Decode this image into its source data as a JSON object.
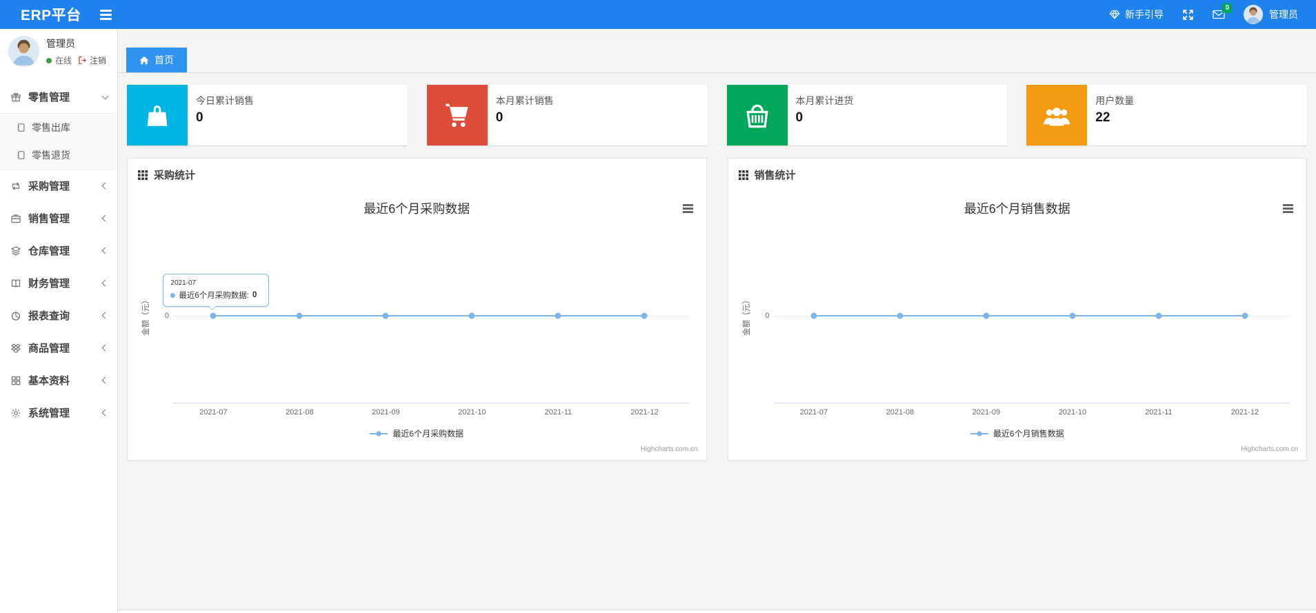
{
  "colors": {
    "navbar": "#1e82ec",
    "active_tab": "#3193f0",
    "series_line": "#7cb5ec",
    "badge_green": "#00a65a",
    "online_green": "#3c9a40",
    "logout_red": "#dd4b39"
  },
  "navbar": {
    "brand": "ERP平台",
    "guide_label": "新手引导",
    "mail_badge": "0",
    "user_name": "管理员"
  },
  "sidebar": {
    "user": {
      "name": "管理员",
      "status": "在线",
      "logout": "注销"
    },
    "menu": [
      {
        "label": "零售管理",
        "icon": "gift-icon",
        "expanded": true,
        "children": [
          {
            "label": "零售出库",
            "icon": "journal-icon"
          },
          {
            "label": "零售退货",
            "icon": "journal-icon"
          }
        ]
      },
      {
        "label": "采购管理",
        "icon": "repeat-icon"
      },
      {
        "label": "销售管理",
        "icon": "briefcase-icon"
      },
      {
        "label": "仓库管理",
        "icon": "layers-icon"
      },
      {
        "label": "财务管理",
        "icon": "book-open-icon"
      },
      {
        "label": "报表查询",
        "icon": "pie-chart-icon"
      },
      {
        "label": "商品管理",
        "icon": "dropbox-icon"
      },
      {
        "label": "基本资料",
        "icon": "grid-icon"
      },
      {
        "label": "系统管理",
        "icon": "gear-icon"
      }
    ]
  },
  "breadcrumb": {
    "home_label": "首页"
  },
  "stat_cards": [
    {
      "label": "今日累计销售",
      "value": "0",
      "color": "#00b4e4",
      "icon": "shopping-bag-icon"
    },
    {
      "label": "本月累计销售",
      "value": "0",
      "color": "#dd4b39",
      "icon": "shopping-cart-icon"
    },
    {
      "label": "本月累计进货",
      "value": "0",
      "color": "#00a65a",
      "icon": "shopping-basket-icon"
    },
    {
      "label": "用户数量",
      "value": "22",
      "color": "#f39c12",
      "icon": "users-icon"
    }
  ],
  "chart_data": [
    {
      "type": "line",
      "panel_title": "采购统计",
      "title": "最近6个月采购数据",
      "categories": [
        "2021-07",
        "2021-08",
        "2021-09",
        "2021-10",
        "2021-11",
        "2021-12"
      ],
      "series": [
        {
          "name": "最近6个月采购数据",
          "values": [
            0,
            0,
            0,
            0,
            0,
            0
          ],
          "color": "#7cb5ec"
        }
      ],
      "xlabel": "",
      "ylabel": "金额（元）",
      "y_tick": "0",
      "ylim": [
        -1,
        1
      ],
      "grid": "horizontal-zero-line-only",
      "legend_position": "bottom",
      "credit": "Highcharts.com.cn",
      "tooltip": {
        "visible": true,
        "date": "2021-07",
        "series_label": "最近6个月采购数据:",
        "value": "0"
      }
    },
    {
      "type": "line",
      "panel_title": "销售统计",
      "title": "最近6个月销售数据",
      "categories": [
        "2021-07",
        "2021-08",
        "2021-09",
        "2021-10",
        "2021-11",
        "2021-12"
      ],
      "series": [
        {
          "name": "最近6个月销售数据",
          "values": [
            0,
            0,
            0,
            0,
            0,
            0
          ],
          "color": "#7cb5ec"
        }
      ],
      "xlabel": "",
      "ylabel": "金额（元）",
      "y_tick": "0",
      "ylim": [
        -1,
        1
      ],
      "grid": "horizontal-zero-line-only",
      "legend_position": "bottom",
      "credit": "Highcharts.com.cn",
      "tooltip": {
        "visible": false
      }
    }
  ]
}
